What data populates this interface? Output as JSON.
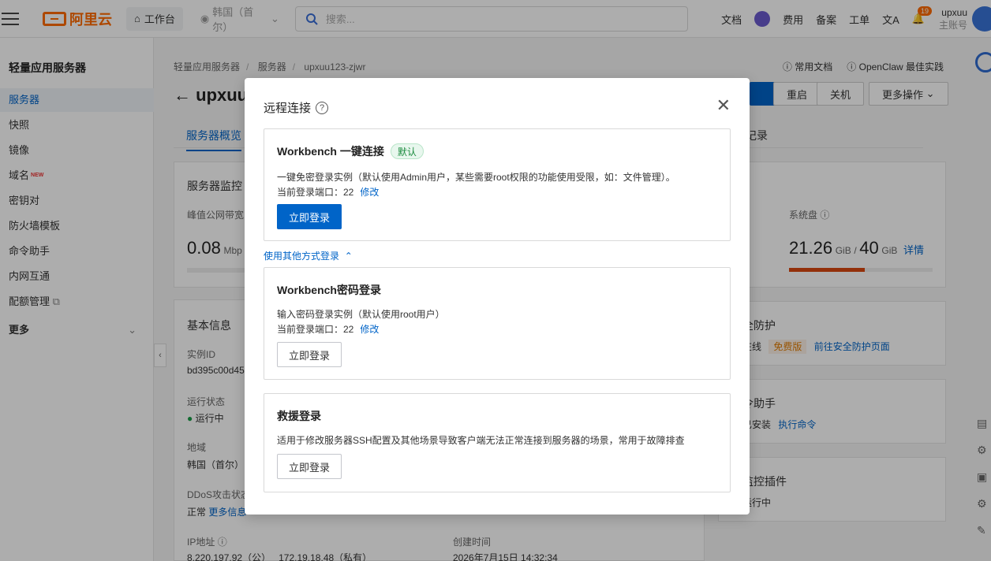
{
  "topbar": {
    "logo_text": "阿里云",
    "workbench": "工作台",
    "region": "韩国（首尔）",
    "search_placeholder": "搜索...",
    "links": [
      "文档",
      "费用",
      "备案",
      "工单"
    ],
    "notification_count": "19",
    "user_name": "upxuu",
    "user_sub": "主账号"
  },
  "sidebar": {
    "title": "轻量应用服务器",
    "items": [
      {
        "label": "服务器"
      },
      {
        "label": "快照"
      },
      {
        "label": "镜像"
      },
      {
        "label": "域名",
        "tag": "NEW"
      },
      {
        "label": "密钥对"
      },
      {
        "label": "防火墙模板"
      },
      {
        "label": "命令助手"
      },
      {
        "label": "内网互通"
      },
      {
        "label": "配额管理"
      },
      {
        "label": "更多"
      }
    ]
  },
  "page": {
    "breadcrumb": [
      "轻量应用服务器",
      "服务器",
      "upxuu123-zjwr"
    ],
    "help_links": [
      "常用文档",
      "OpenClaw 最佳实践"
    ],
    "title": "upxuu",
    "buttons": {
      "restart": "重启",
      "shutdown": "关机",
      "more_ops": "更多操作"
    },
    "tabs": {
      "overview": "服务器概览",
      "records": "记录"
    },
    "monitor": {
      "title": "服务器监控",
      "bandwidth_label": "峰值公网带宽",
      "bandwidth_value": "0.08",
      "bandwidth_unit": "Mbp",
      "disk_label": "系统盘",
      "disk_used": "21.26",
      "disk_used_unit": "GiB",
      "disk_total": "40",
      "disk_total_unit": "GiB",
      "disk_detail": "详情",
      "disk_fraction": 0.53
    },
    "basic": {
      "title": "基本信息",
      "instance_label": "实例ID",
      "instance_value": "bd395c00d45",
      "status_label": "运行状态",
      "status_value": "运行中",
      "region_label": "地域",
      "region_value": "韩国（首尔）",
      "ddos_label": "DDoS攻击状态",
      "ddos_value": "正常",
      "ddos_link": "更多信息",
      "ip_label": "IP地址",
      "ip_public": "8.220.197.92（公）",
      "ip_private": "172.19.18.48（私有）",
      "created_label": "创建时间",
      "created_value": "2026年7月15日 14:32:34"
    },
    "security": {
      "title": "全防护",
      "status": "在线",
      "tag": "免费版",
      "link": "前往安全防护页面"
    },
    "cmd": {
      "title": "令助手",
      "status": "已安装",
      "link": "执行命令"
    },
    "monitor_plugin": {
      "title": "监控插件",
      "status": "运行中"
    }
  },
  "modal": {
    "title": "远程连接",
    "workbench_one_click": {
      "heading": "Workbench 一键连接",
      "tag": "默认",
      "desc": "一键免密登录实例（默认使用Admin用户，某些需要root权限的功能使用受限，如：文件管理）。",
      "port_text": "当前登录端口：22",
      "modify": "修改",
      "button": "立即登录"
    },
    "other_toggle": "使用其他方式登录",
    "workbench_password": {
      "heading": "Workbench密码登录",
      "desc": "输入密码登录实例（默认使用root用户）",
      "port_text": "当前登录端口：22",
      "modify": "修改",
      "button": "立即登录"
    },
    "rescue": {
      "heading": "救援登录",
      "desc": "适用于修改服务器SSH配置及其他场景导致客户端无法正常连接到服务器的场景，常用于故障排查",
      "button": "立即登录"
    }
  }
}
